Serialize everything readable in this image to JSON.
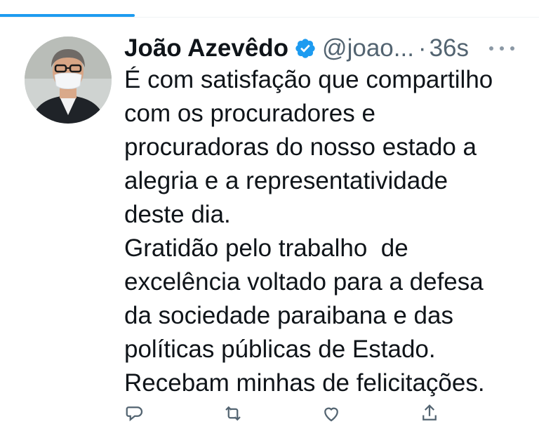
{
  "tweet": {
    "author_name": "João Azevêdo",
    "handle": "@joao...",
    "separator": "·",
    "timestamp": "36s",
    "body_lines": [
      "É com satisfação que compartilho",
      "com os procuradores e",
      "procuradoras do nosso estado a",
      "alegria e a representatividade",
      "deste dia.",
      "Gratidão pelo trabalho  de",
      "excelência voltado para a defesa",
      "da sociedade paraibana e das",
      "políticas públicas de Estado.",
      "Recebam minhas de felicitações."
    ]
  },
  "icons": {
    "avatar": "profile-photo",
    "verified": "verified-badge-icon",
    "more": "more-options-icon",
    "reply": "reply-icon",
    "retweet": "retweet-icon",
    "like": "like-icon",
    "share": "share-icon"
  },
  "colors": {
    "accent": "#1d9bf0",
    "text_primary": "#0f1419",
    "text_secondary": "#536471"
  }
}
